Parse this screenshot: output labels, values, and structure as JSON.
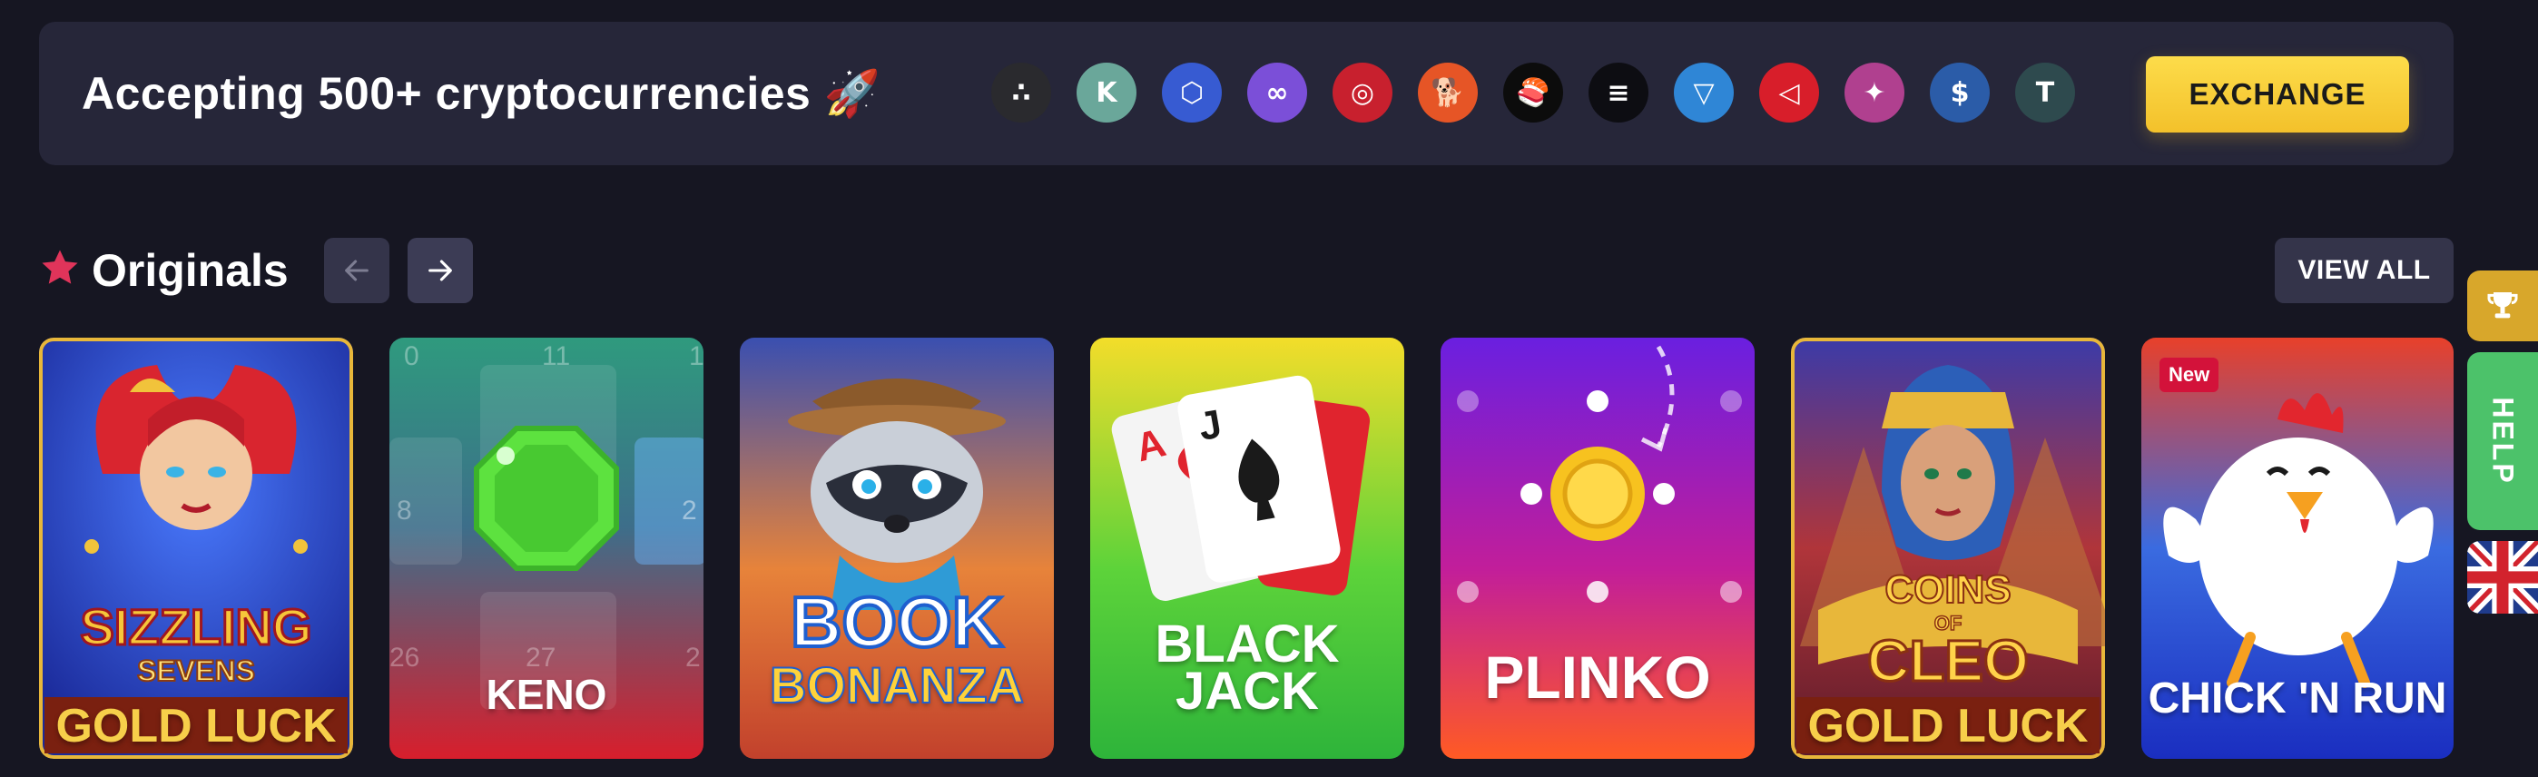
{
  "banner": {
    "title": "Accepting 500+ cryptocurrencies 🚀",
    "exchange_label": "EXCHANGE",
    "coins": [
      {
        "icon": "iota-icon",
        "color": "#2a2a2e",
        "glyph": "∴"
      },
      {
        "icon": "kaspa-icon",
        "color": "#6aa79a",
        "glyph": "K"
      },
      {
        "icon": "chainlink-icon",
        "color": "#375bd2",
        "glyph": "⬡"
      },
      {
        "icon": "polygon-icon",
        "color": "#7b4fd8",
        "glyph": "∞"
      },
      {
        "icon": "ravencoin-icon",
        "color": "#c8202e",
        "glyph": "◎"
      },
      {
        "icon": "shiba-inu-icon",
        "color": "#e65526",
        "glyph": "🐕"
      },
      {
        "icon": "sushi-icon",
        "color": "#0c0c0c",
        "glyph": "🍣"
      },
      {
        "icon": "solana-icon",
        "color": "#0d0d12",
        "glyph": "≡"
      },
      {
        "icon": "toncoin-icon",
        "color": "#2f86d6",
        "glyph": "▽"
      },
      {
        "icon": "tron-icon",
        "color": "#d81e2a",
        "glyph": "◁"
      },
      {
        "icon": "bnb-chain-purple-icon",
        "color": "#b0408f",
        "glyph": "✦"
      },
      {
        "icon": "usd-coin-icon",
        "color": "#2b5ca8",
        "glyph": "$"
      },
      {
        "icon": "tether-icon",
        "color": "#2e4a4e",
        "glyph": "T"
      }
    ]
  },
  "originals": {
    "title": "Originals",
    "view_all_label": "VIEW ALL",
    "games": [
      {
        "name": "game-card-sizzling-sevens",
        "label": "GOLD LUCK"
      },
      {
        "name": "game-card-keno",
        "label": "KENO"
      },
      {
        "name": "game-card-book-bonanza",
        "label": "BONANZA"
      },
      {
        "name": "game-card-blackjack",
        "label": "BLACK JACK"
      },
      {
        "name": "game-card-plinko",
        "label": "PLINKO"
      },
      {
        "name": "game-card-coins-of-cleo",
        "label": "GOLD LUCK"
      },
      {
        "name": "game-card-chick-n-run",
        "label": "CHICK 'N RUN",
        "badge": "New"
      }
    ],
    "card_text": {
      "sizzling": "SIZZLING",
      "sevens": "SEVENS",
      "book": "BOOK",
      "coins": "COINS",
      "of": "OF",
      "cleo": "CLEO",
      "blackjack_line1": "BLACK",
      "blackjack_line2": "JACK",
      "ace": "A",
      "jack": "J",
      "keno_numbers": [
        "0",
        "11",
        "1",
        "8",
        "2",
        "26",
        "27",
        "2"
      ]
    }
  },
  "sidebar_widgets": {
    "help_label": "HELP"
  },
  "colors": {
    "background": "#161622",
    "panel": "#262639",
    "accent_yellow": "#f3c12b",
    "star_red": "#e0345a",
    "help_green": "#4cc26a",
    "trophy_gold": "#d8a72b"
  }
}
